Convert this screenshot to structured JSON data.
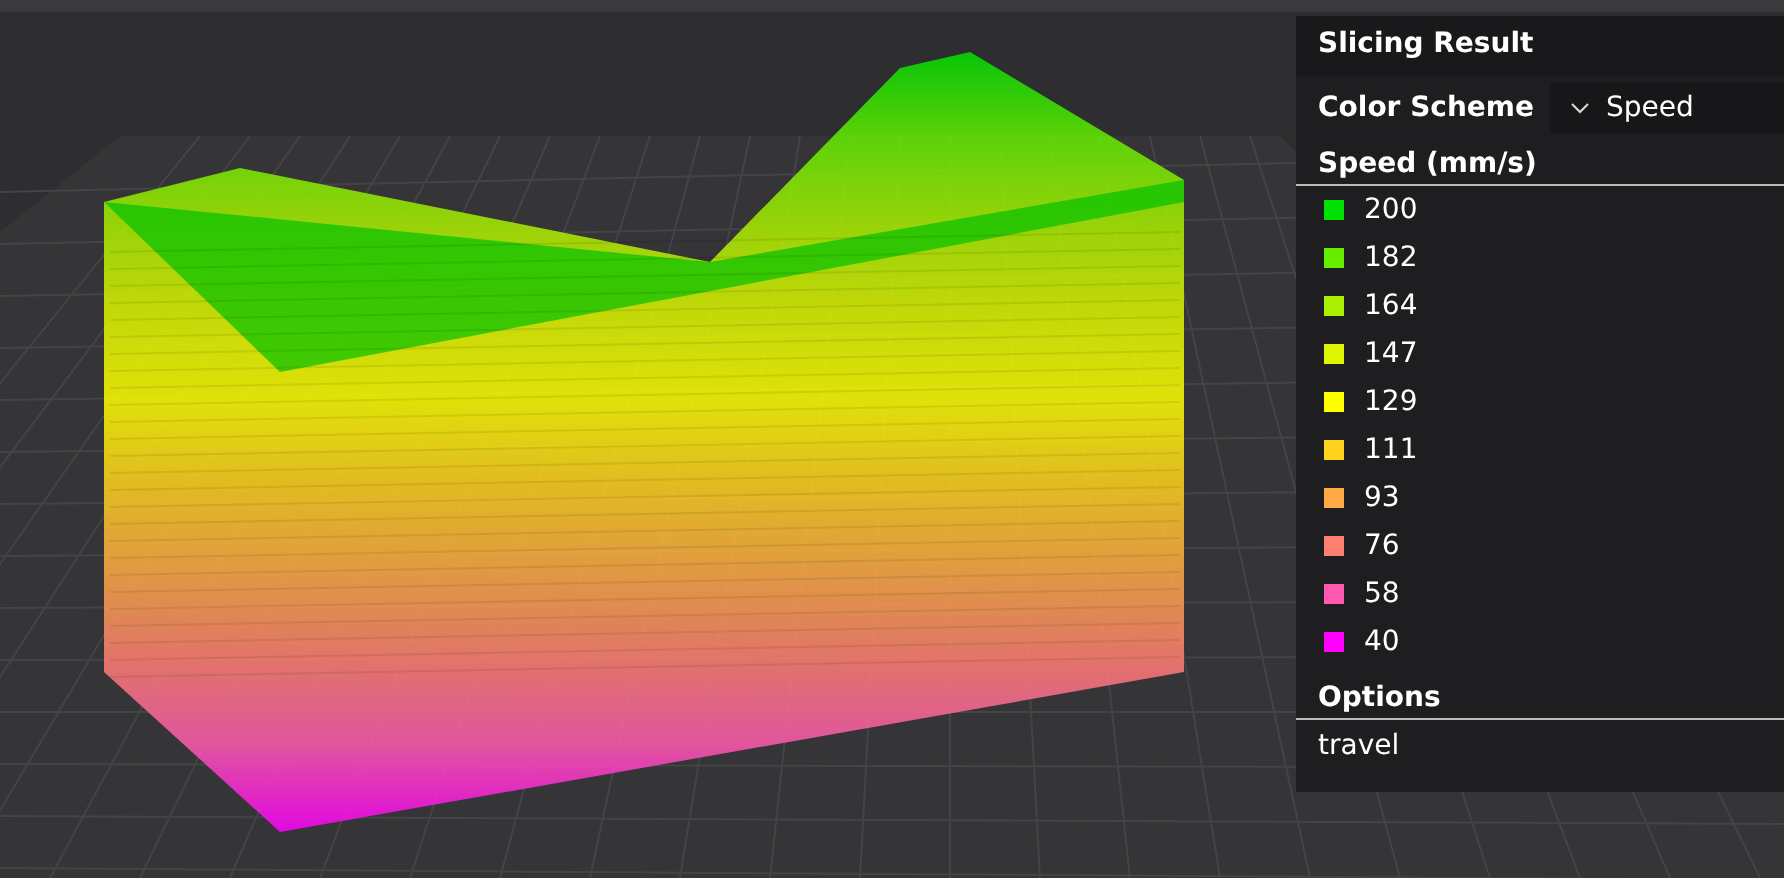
{
  "panel": {
    "title": "Slicing Result",
    "color_scheme": {
      "label": "Color Scheme",
      "value": "Speed"
    },
    "legend": {
      "title": "Speed (mm/s)",
      "items": [
        {
          "label": "200",
          "color": "#00e000"
        },
        {
          "label": "182",
          "color": "#66ee00"
        },
        {
          "label": "164",
          "color": "#aaee00"
        },
        {
          "label": "147",
          "color": "#ddf500"
        },
        {
          "label": "129",
          "color": "#ffff00"
        },
        {
          "label": "111",
          "color": "#ffd21e"
        },
        {
          "label": "93",
          "color": "#ffaa44"
        },
        {
          "label": "76",
          "color": "#ff8070"
        },
        {
          "label": "58",
          "color": "#ff5ab0"
        },
        {
          "label": "40",
          "color": "#ff00ff"
        }
      ]
    },
    "options": {
      "title": "Options",
      "items": [
        "travel"
      ]
    }
  }
}
